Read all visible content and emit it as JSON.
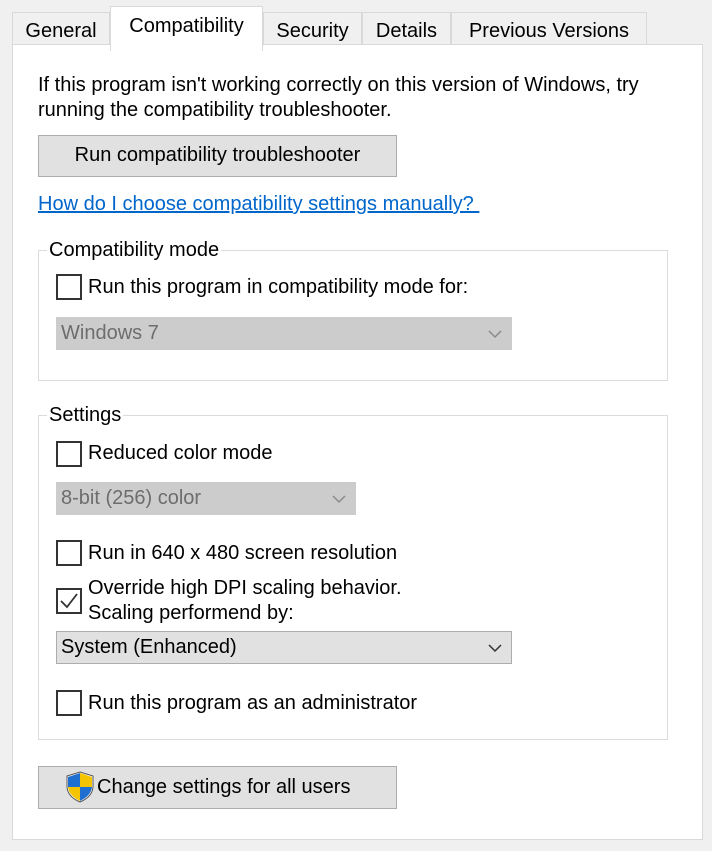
{
  "tabs": [
    {
      "label": "General"
    },
    {
      "label": "Compatibility",
      "active": true
    },
    {
      "label": "Security"
    },
    {
      "label": "Details"
    },
    {
      "label": "Previous Versions"
    }
  ],
  "intro_text": "If this program isn't working correctly on this version of Windows, try running the compatibility troubleshooter.",
  "troubleshooter_button": "Run compatibility troubleshooter",
  "help_link": "How do I choose compatibility settings manually? ",
  "compat_mode": {
    "legend": "Compatibility mode",
    "checkbox_label": "Run this program in compatibility mode for:",
    "checked": false,
    "os_select": {
      "value": "Windows 7",
      "enabled": false
    }
  },
  "settings": {
    "legend": "Settings",
    "reduced_color": {
      "label": "Reduced color mode",
      "checked": false
    },
    "color_select": {
      "value": "8-bit (256) color",
      "enabled": false
    },
    "resolution": {
      "label": "Run in 640 x 480 screen resolution",
      "checked": false
    },
    "dpi": {
      "label_line1": "Override high DPI scaling behavior.",
      "label_line2": "Scaling performend by:",
      "checked": true
    },
    "dpi_select": {
      "value": "System (Enhanced)",
      "enabled": true
    },
    "admin": {
      "label": "Run this program as an administrator",
      "checked": false
    }
  },
  "change_all_users_button": "Change settings for all users",
  "icons": {
    "shield": "uac-shield-icon",
    "checkmark": "checkmark-icon",
    "chevron": "chevron-down-icon"
  },
  "colors": {
    "link": "#0066cc",
    "button_bg": "#e1e1e1",
    "disabled_select": "#cccccc",
    "window_bg": "#f0f0f0"
  }
}
